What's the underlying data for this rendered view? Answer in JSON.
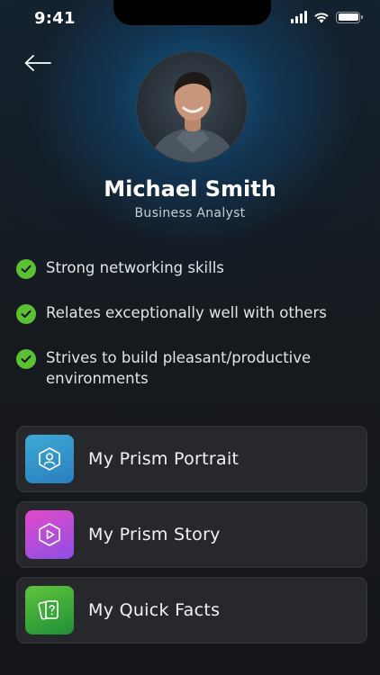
{
  "status_bar": {
    "time": "9:41"
  },
  "profile": {
    "name": "Michael Smith",
    "role": "Business Analyst"
  },
  "traits": [
    "Strong networking skills",
    "Relates exceptionally well with others",
    "Strives to build pleasant/productive environments"
  ],
  "cards": [
    {
      "label": "My Prism Portrait",
      "icon": "portrait-icon"
    },
    {
      "label": "My Prism Story",
      "icon": "play-icon"
    },
    {
      "label": "My Quick Facts",
      "icon": "question-cards-icon"
    }
  ],
  "colors": {
    "check": "#5ac232",
    "card_bg": "#26282c",
    "portrait_tile": "#2a7ec0",
    "story_tile": "#b84bd8",
    "facts_tile": "#3aa63a"
  }
}
